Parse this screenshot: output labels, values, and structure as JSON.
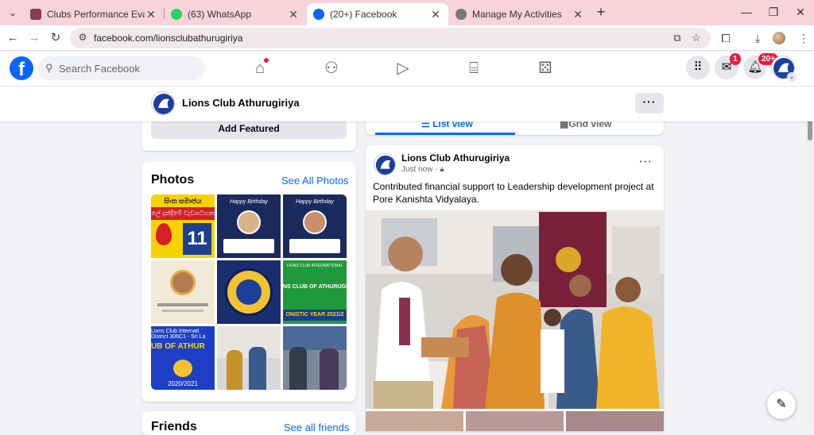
{
  "browser": {
    "tabs": [
      {
        "title": "Clubs Performance Evaluation S",
        "icon": "lions-favicon",
        "color": "#8a3b56"
      },
      {
        "title": "(63) WhatsApp",
        "icon": "whatsapp-favicon",
        "color": "#25d366"
      },
      {
        "title": "(20+) Facebook",
        "icon": "facebook-favicon",
        "color": "#0866ff"
      },
      {
        "title": "Manage My Activities",
        "icon": "globe-favicon",
        "color": "#666666"
      }
    ],
    "url": "facebook.com/lionsclubathurugiriya",
    "tab_strip_color": "#f8d3dc"
  },
  "fb": {
    "search_placeholder": "Search Facebook",
    "messenger_badge": "1",
    "notifications_badge": "20+",
    "brand_color": "#0866ff"
  },
  "page": {
    "name": "Lions Club Athurugiriya",
    "more_label": "···"
  },
  "left": {
    "add_featured": "Add Featured",
    "photos_title": "Photos",
    "see_all_photos": "See All Photos",
    "friends_title": "Friends",
    "see_all_friends": "See all friends"
  },
  "feed": {
    "list_view": "List view",
    "grid_view": "Grid view",
    "post": {
      "author": "Lions Club Athurugiriya",
      "time": "Just now ·",
      "text": "Contributed financial support to Leadership development project at Pore Kanishta Vidyalaya."
    }
  },
  "thumbs": {
    "t1": {
      "l1": "සිංත සමාජය",
      "l2": "ලේ දන්දීමේ වැඩසටහන",
      "num": "11"
    },
    "t2": {
      "l1": "Happy Birthday"
    },
    "t3": {
      "l1": "Happy Birthday"
    },
    "t6": {
      "l1": "LIONS CLUB INTERNATIONAL",
      "l2": "NS CLUB OF ATHURUGI",
      "l3": "ONISTIC YEAR 2021/2"
    },
    "t7": {
      "l1": "Lions Club Internati",
      "l2": "District 306C1 - Sri La",
      "l3": "UB OF ATHUR",
      "l4": "2020/2021"
    }
  }
}
